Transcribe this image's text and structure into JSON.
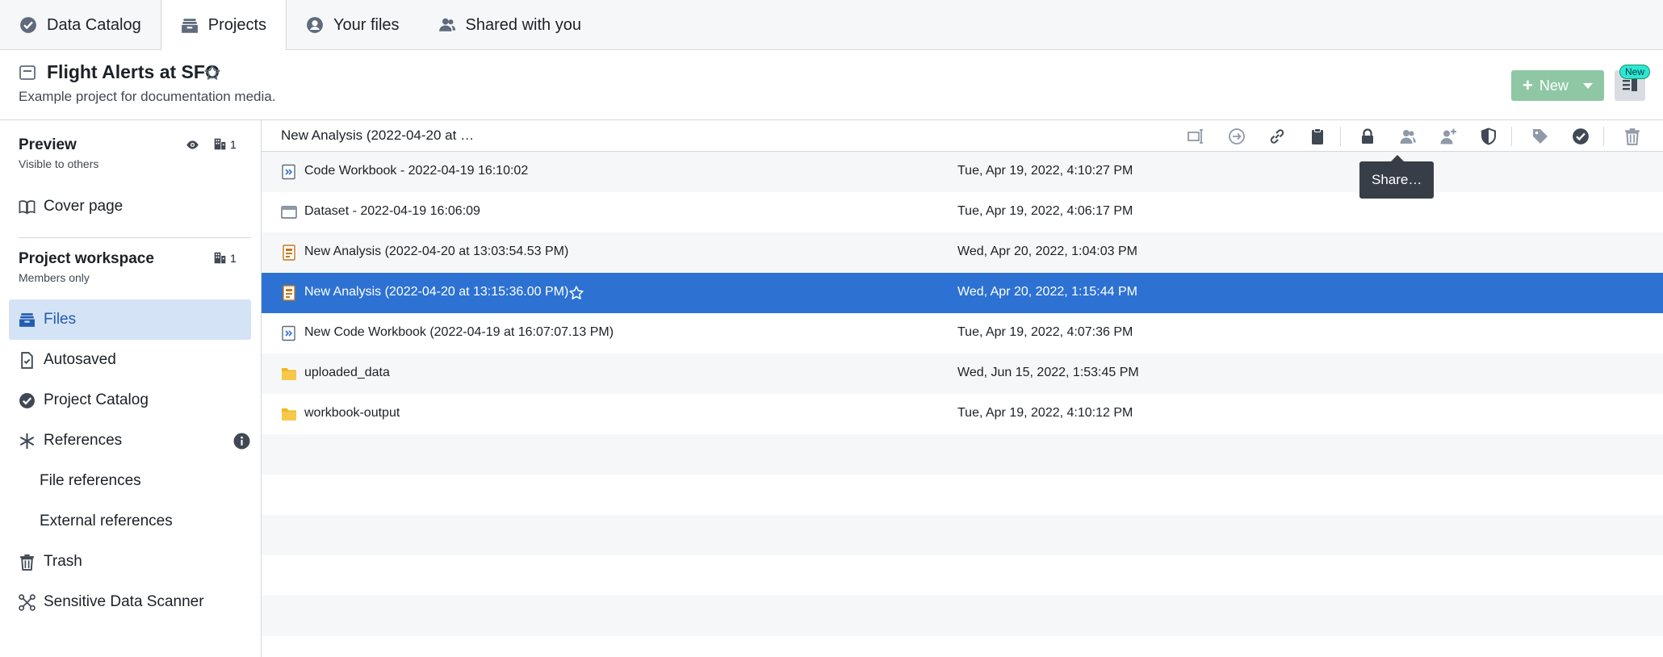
{
  "top_tabs": [
    {
      "label": "Data Catalog",
      "icon": "check-circle-icon"
    },
    {
      "label": "Projects",
      "icon": "projects-icon"
    },
    {
      "label": "Your files",
      "icon": "user-icon"
    },
    {
      "label": "Shared with you",
      "icon": "people-icon"
    }
  ],
  "active_tab": "Projects",
  "project": {
    "title": "Flight Alerts at SFO",
    "description": "Example project for documentation media."
  },
  "header_actions": {
    "new_label": "New",
    "new_badge": "New"
  },
  "sidebar": {
    "preview": {
      "title": "Preview",
      "subtitle": "Visible to others",
      "count": "1"
    },
    "cover_page": "Cover page",
    "workspace": {
      "title": "Project workspace",
      "subtitle": "Members only",
      "count": "1"
    },
    "items": [
      {
        "label": "Files",
        "icon": "files-icon",
        "active": true
      },
      {
        "label": "Autosaved",
        "icon": "autosaved-icon"
      },
      {
        "label": "Project Catalog",
        "icon": "check-circle-icon"
      },
      {
        "label": "References",
        "icon": "asterisk-icon"
      },
      {
        "label": "File references",
        "sub": true
      },
      {
        "label": "External references",
        "sub": true
      },
      {
        "label": "Trash",
        "icon": "trash-icon"
      },
      {
        "label": "Sensitive Data Scanner",
        "icon": "scanner-icon"
      }
    ]
  },
  "breadcrumb": "New Analysis (2022-04-20 at …",
  "toolbar_icons": [
    "rename-icon",
    "move-icon",
    "link-icon",
    "clipboard-icon",
    "lock-icon",
    "share-icon",
    "add-user-icon",
    "shield-icon",
    "tag-icon",
    "check-circle-icon",
    "trash-icon"
  ],
  "tooltip": "Share…",
  "files": [
    {
      "name": "Code Workbook - 2022-04-19 16:10:02",
      "date": "Tue, Apr 19, 2022, 4:10:27 PM",
      "type": "code-workbook-icon"
    },
    {
      "name": "Dataset - 2022-04-19 16:06:09",
      "date": "Tue, Apr 19, 2022, 4:06:17 PM",
      "type": "dataset-icon"
    },
    {
      "name": "New Analysis (2022-04-20 at 13:03:54.53 PM)",
      "date": "Wed, Apr 20, 2022, 1:04:03 PM",
      "type": "analysis-icon"
    },
    {
      "name": "New Analysis (2022-04-20 at 13:15:36.00 PM)",
      "date": "Wed, Apr 20, 2022, 1:15:44 PM",
      "type": "analysis-icon",
      "selected": true
    },
    {
      "name": "New Code Workbook (2022-04-19 at 16:07:07.13 PM)",
      "date": "Tue, Apr 19, 2022, 4:07:36 PM",
      "type": "code-workbook-icon"
    },
    {
      "name": "uploaded_data",
      "date": "Wed, Jun 15, 2022, 1:53:45 PM",
      "type": "folder-icon"
    },
    {
      "name": "workbook-output",
      "date": "Tue, Apr 19, 2022, 4:10:12 PM",
      "type": "folder-icon"
    }
  ],
  "colors": {
    "selection": "#2d72d2",
    "folder": "#f0b726",
    "new_button": "#8fc7a4",
    "active_nav": "#d5e3f6"
  }
}
